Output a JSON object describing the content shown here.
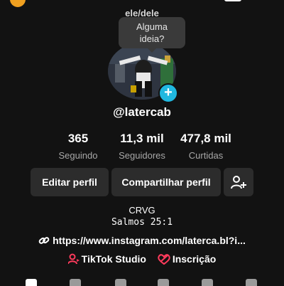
{
  "header": {
    "pronouns": "ele/dele"
  },
  "tooltip": {
    "line1": "Alguma",
    "line2": "ideia?"
  },
  "profile": {
    "username": "@latercab",
    "avatar_add_symbol": "+"
  },
  "stats": [
    {
      "value": "365",
      "label": "Seguindo"
    },
    {
      "value": "11,3 mil",
      "label": "Seguidores"
    },
    {
      "value": "477,8 mil",
      "label": "Curtidas"
    }
  ],
  "actions": {
    "edit_label": "Editar perfil",
    "share_label": "Compartilhar perfil",
    "add_friend_icon": "add-user-icon"
  },
  "bio": {
    "line1": "CRVG",
    "line2": "Salmos 25:1",
    "link": "https://www.instagram.com/laterca.bl?i..."
  },
  "extras": {
    "studio_label": "TikTok Studio",
    "subscription_label": "Inscrição"
  },
  "colors": {
    "background": "#121212",
    "button": "#2c2c2c",
    "accent_plus": "#20b8e0",
    "icon_red": "#ff3b5c"
  }
}
